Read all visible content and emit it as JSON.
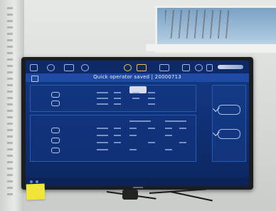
{
  "screen": {
    "title": "Quick operator saved | 20000713"
  },
  "icons": [
    "menu-icon",
    "wheel-icon",
    "car-icon",
    "globe-icon",
    "target-icon",
    "alignment-icon",
    "printer-icon",
    "save-icon",
    "info-icon",
    "trash-icon"
  ]
}
